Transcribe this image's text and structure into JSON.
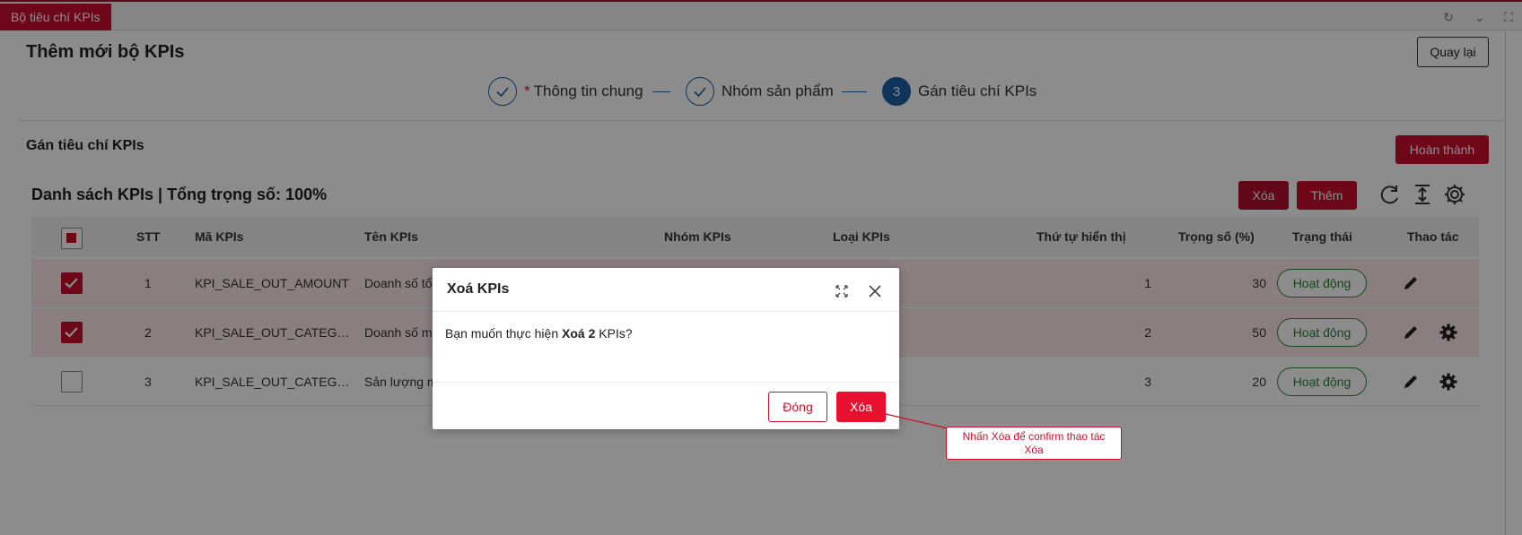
{
  "topbar": {
    "active_tab": "Bộ tiêu chí KPIs"
  },
  "page": {
    "title": "Thêm mới bộ KPIs",
    "back_button": "Quay lại"
  },
  "steps": [
    {
      "label": "Thông tin chung",
      "required_mark": "*",
      "state": "done"
    },
    {
      "label": "Nhóm sản phẩm",
      "state": "done"
    },
    {
      "number": "3",
      "label": "Gán tiêu chí KPIs",
      "state": "active"
    }
  ],
  "section": {
    "title": "Gán tiêu chí KPIs",
    "finish_button": "Hoàn thành"
  },
  "list": {
    "title": "Danh sách KPIs | Tổng trọng số: 100%",
    "delete_button": "Xóa",
    "add_button": "Thêm"
  },
  "table": {
    "headers": {
      "stt": "STT",
      "code": "Mã KPIs",
      "name": "Tên KPIs",
      "group": "Nhóm KPIs",
      "type": "Loại KPIs",
      "order": "Thứ tự hiển thị",
      "weight": "Trọng số (%)",
      "status": "Trạng thái",
      "actions": "Thao tác"
    },
    "rows": [
      {
        "stt": "1",
        "code": "KPI_SALE_OUT_AMOUNT",
        "name": "Doanh số tổ",
        "order": "1",
        "weight": "30",
        "status": "Hoạt động",
        "checked": true,
        "has_settings": false
      },
      {
        "stt": "2",
        "code": "KPI_SALE_OUT_CATEGOR...",
        "name": "Doanh số m",
        "order": "2",
        "weight": "50",
        "status": "Hoạt động",
        "checked": true,
        "has_settings": true
      },
      {
        "stt": "3",
        "code": "KPI_SALE_OUT_CATEGOR...",
        "name": "Sản lượng m",
        "order": "3",
        "weight": "20",
        "status": "Hoạt động",
        "checked": false,
        "has_settings": true
      }
    ]
  },
  "modal": {
    "title": "Xoá KPIs",
    "body_prefix": "Bạn muốn thực hiện ",
    "body_bold": "Xoá 2",
    "body_suffix": " KPIs?",
    "close_button": "Đóng",
    "confirm_button": "Xóa"
  },
  "callout": {
    "line1": "Nhấn Xóa để confirm thao tác",
    "line2": "Xóa"
  },
  "colors": {
    "brand_red": "#c8102e",
    "step_blue": "#1f5fa5",
    "status_green": "#2e7d32"
  }
}
